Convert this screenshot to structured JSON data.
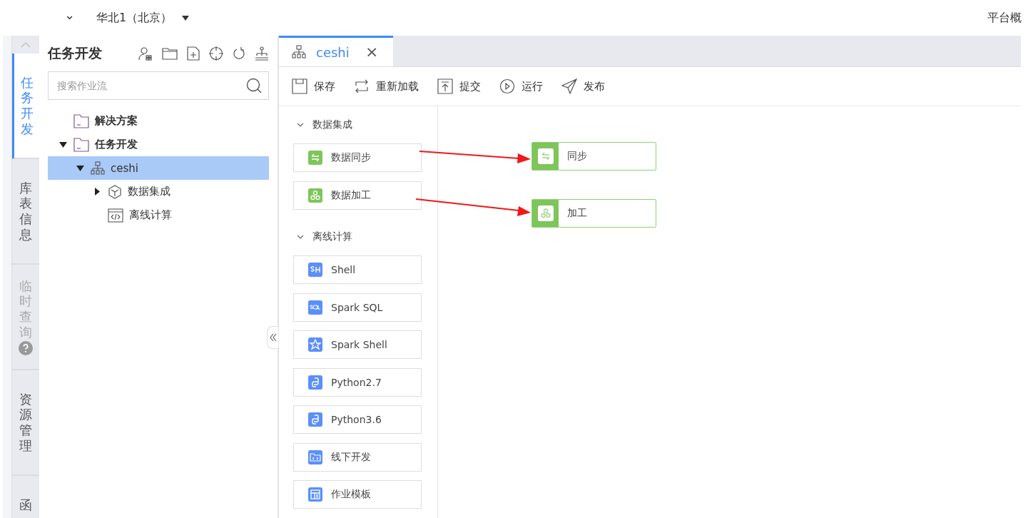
{
  "top_bar": {
    "caret": "⌄",
    "region": "华北1（北京）",
    "right_link": "平台概"
  },
  "side_nav": [
    {
      "label": "任务开发",
      "selected": true,
      "disabled": false,
      "help": false
    },
    {
      "label": "库表信息",
      "selected": false,
      "disabled": false,
      "help": false
    },
    {
      "label": "临时查询",
      "selected": false,
      "disabled": true,
      "help": true
    },
    {
      "label": "资源管理",
      "selected": false,
      "disabled": false,
      "help": false
    },
    {
      "label": "函",
      "selected": false,
      "disabled": false,
      "help": false
    }
  ],
  "tree_panel": {
    "title": "任务开发",
    "search": {
      "placeholder": "搜索作业流"
    },
    "items": [
      {
        "label": "解决方案",
        "kind": "folder",
        "selected": false
      },
      {
        "label": "任务开发",
        "kind": "folder",
        "selected": false,
        "expanded": true,
        "children": [
          {
            "label": "ceshi",
            "kind": "flow",
            "selected": true,
            "expanded": true,
            "children": [
              {
                "label": "数据集成",
                "kind": "cube",
                "selected": false,
                "expanded": false
              },
              {
                "label": "离线计算",
                "kind": "code",
                "selected": false
              }
            ]
          }
        ]
      }
    ]
  },
  "tabs": [
    {
      "label": "ceshi",
      "selected": true,
      "close": "×"
    }
  ],
  "toolbar": [
    {
      "label": "保存",
      "kind": "save"
    },
    {
      "label": "重新加载",
      "kind": "reload"
    },
    {
      "label": "提交",
      "kind": "submit"
    },
    {
      "label": "运行",
      "kind": "run"
    },
    {
      "label": "发布",
      "kind": "publish"
    }
  ],
  "palette": [
    {
      "title": "数据集成",
      "expanded": true,
      "items": [
        {
          "label": "数据同步",
          "kind": "sync"
        },
        {
          "label": "数据加工",
          "kind": "process"
        }
      ]
    },
    {
      "title": "离线计算",
      "expanded": true,
      "items": [
        {
          "label": "Shell",
          "kind": "shell"
        },
        {
          "label": "Spark SQL",
          "kind": "sql"
        },
        {
          "label": "Spark Shell",
          "kind": "spark"
        },
        {
          "label": "Python2.7",
          "kind": "python"
        },
        {
          "label": "Python3.6",
          "kind": "python"
        },
        {
          "label": "线下开发",
          "kind": "folder"
        },
        {
          "label": "作业模板",
          "kind": "template"
        }
      ]
    }
  ],
  "canvas_nodes": [
    {
      "label": "同步",
      "kind": "sync"
    },
    {
      "label": "加工",
      "kind": "process"
    }
  ]
}
